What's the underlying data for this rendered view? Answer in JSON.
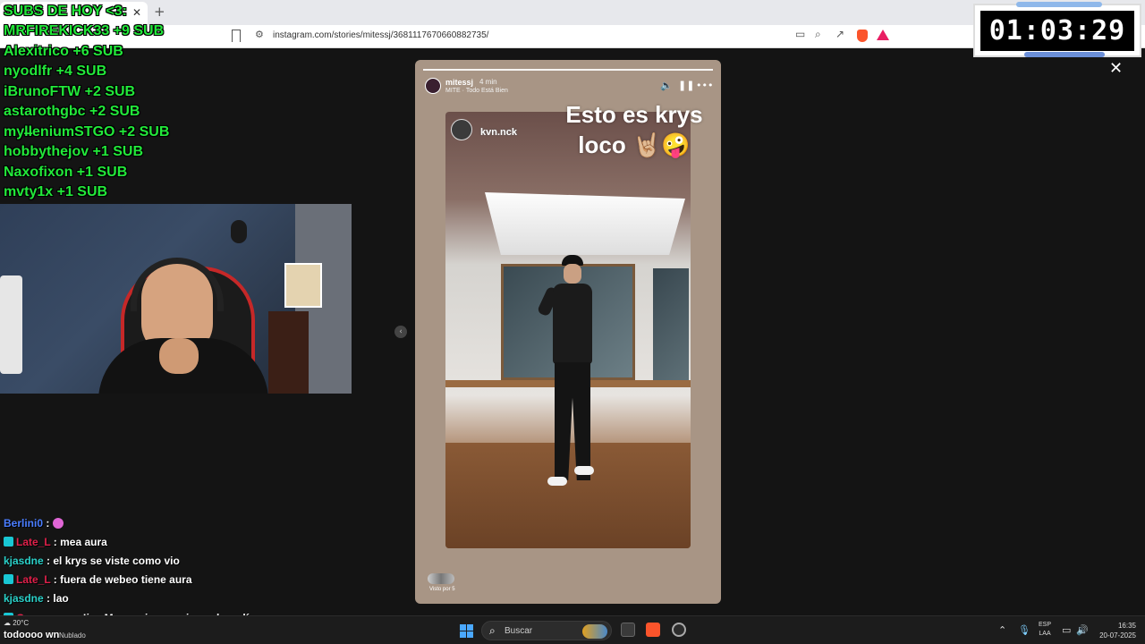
{
  "browser": {
    "tab_title": "SUBS DE HOY <3:",
    "url": "instagram.com/stories/mitessj/3681117670660882735/"
  },
  "subs": [
    {
      "text": "SUBS DE HOY <3:"
    },
    {
      "text": "MRFIREKICK33 +9 SUB"
    },
    {
      "text": "Alexitrico +6 SUB"
    },
    {
      "text": "nyodlfr +4 SUB"
    },
    {
      "text": "iBrunoFTW +2 SUB"
    },
    {
      "text": "astarothgbc +2 SUB"
    },
    {
      "text": "myl̶leniumSTGO +2 SUB"
    },
    {
      "text": "hobbythejov +1 SUB"
    },
    {
      "text": "Naxofixon +1 SUB"
    },
    {
      "text": "mvty1x +1 SUB"
    }
  ],
  "chat": [
    {
      "user": "Berlini0",
      "user_color": "#4a7dff",
      "message": ""
    },
    {
      "user": "Late_L",
      "user_color": "#e0204a",
      "message": "mea aura"
    },
    {
      "user": "kjasdne",
      "user_color": "#2ad0c8",
      "message": "el krys se viste como vio"
    },
    {
      "user": "Late_L",
      "user_color": "#e0204a",
      "message": "fuera de webeo tiene aura"
    },
    {
      "user": "kjasdne",
      "user_color": "#2ad0c8",
      "message": "lao"
    },
    {
      "user": "Goyouwwu",
      "user_color": "#e0204a",
      "message": "!jax Mano mira en mi canal perdí"
    },
    {
      "user": "",
      "user_color": "#ffffff",
      "message": "todoooo wn"
    }
  ],
  "story": {
    "username": "mitessj",
    "time": "4 min",
    "music": "MITE · Todo Está Bien",
    "caption_line1": "Esto es krys",
    "caption_line2": "loco 🤘🏼🤪",
    "tagged_user": "kvn.nck",
    "viewers": "Visto por 5"
  },
  "timer": "01:03:29",
  "taskbar": {
    "weather_temp": "20°C",
    "weather_desc": "Nublado",
    "search_placeholder": "Buscar",
    "lang_line1": "ESP",
    "lang_line2": "LAA",
    "time": "16:35",
    "date": "20-07-2025"
  }
}
